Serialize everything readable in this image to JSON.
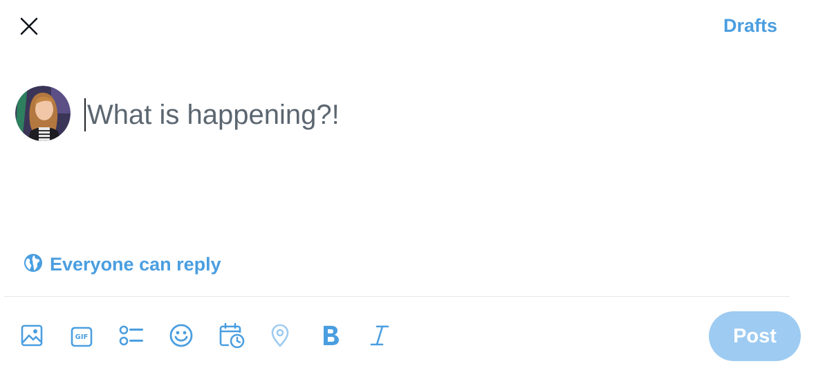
{
  "colors": {
    "accent": "#4a9ee0",
    "accent_disabled": "#9ecbf1",
    "text_primary": "#0f1419",
    "placeholder": "#5b6670",
    "divider": "#e3e6e8"
  },
  "header": {
    "close_icon": "close-icon",
    "drafts_label": "Drafts"
  },
  "composer": {
    "avatar": "user-avatar",
    "placeholder": "What is happening?!",
    "value": ""
  },
  "reply_setting": {
    "icon": "globe-icon",
    "label": "Everyone can reply"
  },
  "toolbar": {
    "icons": [
      "image-icon",
      "gif-icon",
      "poll-icon",
      "emoji-icon",
      "schedule-icon",
      "location-icon",
      "bold-icon",
      "italic-icon"
    ],
    "gif_text": "GIF",
    "post_label": "Post"
  }
}
